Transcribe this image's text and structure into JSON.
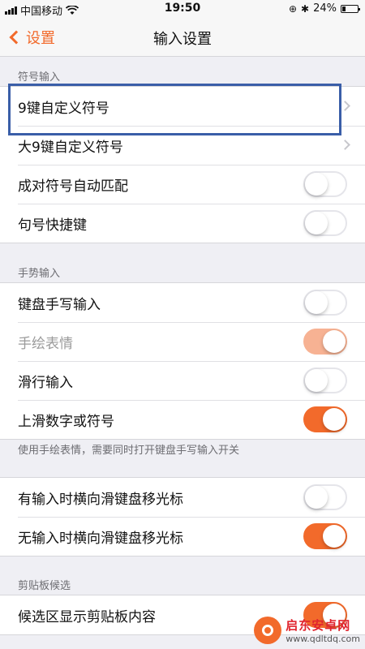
{
  "status_bar": {
    "carrier": "中国移动",
    "time": "19:50",
    "battery": "24%"
  },
  "nav": {
    "back_label": "设置",
    "title": "输入设置"
  },
  "sections": {
    "symbol_input": {
      "header": "符号输入",
      "rows": [
        {
          "label": "9键自定义符号"
        },
        {
          "label": "大9键自定义符号"
        },
        {
          "label": "成对符号自动匹配",
          "toggle": "off"
        },
        {
          "label": "句号快捷键",
          "toggle": "off"
        }
      ]
    },
    "gesture_input": {
      "header": "手势输入",
      "rows": [
        {
          "label": "键盘手写输入",
          "toggle": "off"
        },
        {
          "label": "手绘表情",
          "toggle": "on-disabled"
        },
        {
          "label": "滑行输入",
          "toggle": "off"
        },
        {
          "label": "上滑数字或符号",
          "toggle": "on"
        }
      ],
      "footer": "使用手绘表情，需要同时打开键盘手写输入开关"
    },
    "cursor": {
      "rows": [
        {
          "label": "有输入时横向滑键盘移光标",
          "toggle": "off"
        },
        {
          "label": "无输入时横向滑键盘移光标",
          "toggle": "on"
        }
      ]
    },
    "clipboard": {
      "header": "剪贴板候选",
      "rows": [
        {
          "label": "候选区显示剪贴板内容",
          "toggle": "on"
        }
      ]
    }
  },
  "watermark": {
    "brand": "启东安卓网",
    "url": "www.qdltdq.com"
  },
  "colors": {
    "accent": "#f26a2b",
    "highlight_box": "#3a5ea8"
  }
}
